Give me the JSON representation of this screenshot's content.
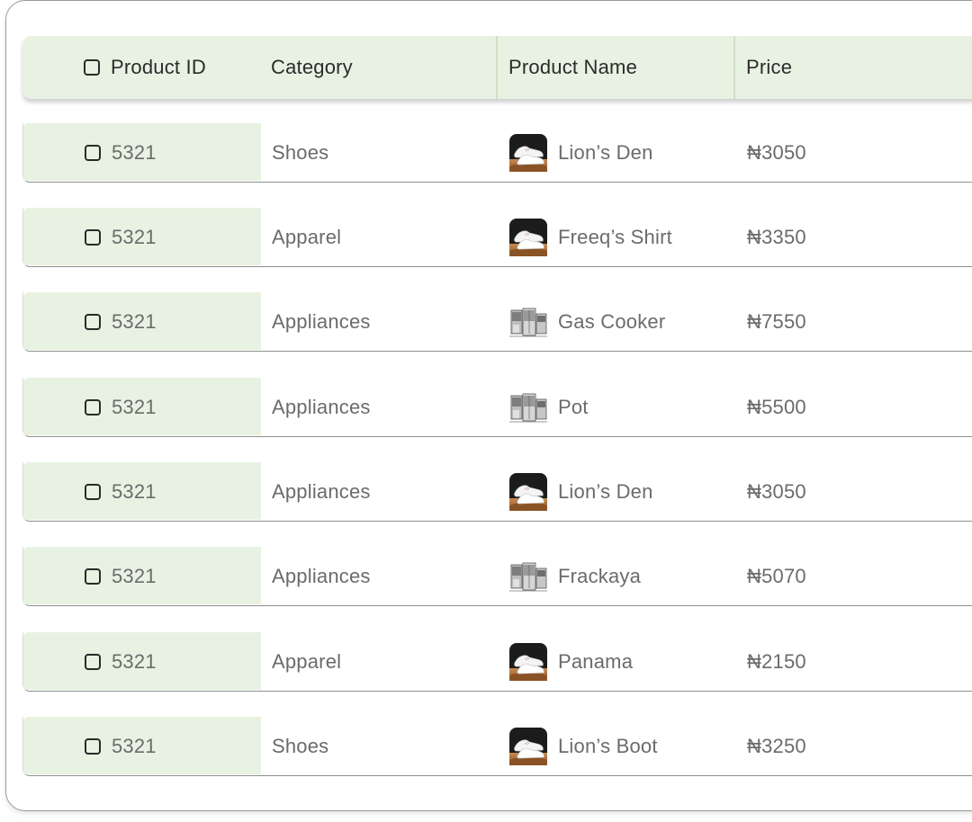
{
  "table": {
    "headers": {
      "product_id": "Product ID",
      "category": "Category",
      "product_name": "Product Name",
      "price": "Price"
    },
    "rows": [
      {
        "id": "5321",
        "category": "Shoes",
        "name": "Lion’s Den",
        "price": "₦3050",
        "thumb": "sneaker-icon"
      },
      {
        "id": "5321",
        "category": "Apparel",
        "name": "Freeq’s Shirt",
        "price": "₦3350",
        "thumb": "sneaker-icon"
      },
      {
        "id": "5321",
        "category": "Appliances",
        "name": "Gas Cooker",
        "price": "₦7550",
        "thumb": "appliances-icon"
      },
      {
        "id": "5321",
        "category": "Appliances",
        "name": "Pot",
        "price": "₦5500",
        "thumb": "appliances-icon"
      },
      {
        "id": "5321",
        "category": "Appliances",
        "name": "Lion’s Den",
        "price": "₦3050",
        "thumb": "sneaker-icon"
      },
      {
        "id": "5321",
        "category": "Appliances",
        "name": "Frackaya",
        "price": "₦5070",
        "thumb": "appliances-icon"
      },
      {
        "id": "5321",
        "category": "Apparel",
        "name": "Panama",
        "price": "₦2150",
        "thumb": "sneaker-icon"
      },
      {
        "id": "5321",
        "category": "Shoes",
        "name": "Lion’s Boot",
        "price": "₦3250",
        "thumb": "sneaker-icon"
      }
    ]
  },
  "colors": {
    "id_column_bg": "#e8f2e2",
    "header_text": "#2b2b2b",
    "cell_text": "#6b6b6b"
  }
}
